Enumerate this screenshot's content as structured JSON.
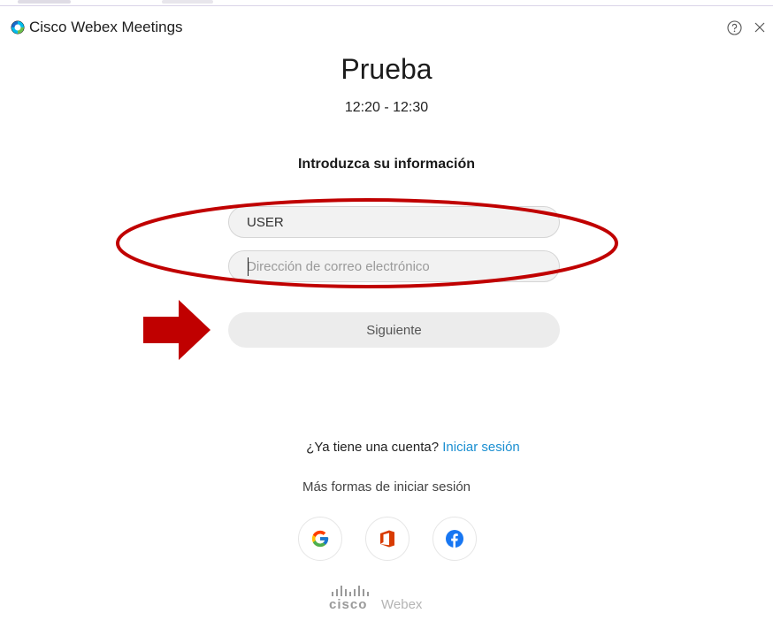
{
  "window": {
    "app_title": "Cisco Webex Meetings",
    "help_icon": "question-circle-icon",
    "close_icon": "close-icon"
  },
  "meeting": {
    "title": "Prueba",
    "time": "12:20 - 12:30"
  },
  "form": {
    "heading": "Introduzca su información",
    "name_value": "USER",
    "email_placeholder": "Dirección de correo electrónico",
    "email_value": "",
    "next_label": "Siguiente"
  },
  "account": {
    "prompt": "¿Ya tiene una cuenta?",
    "signin_label": "Iniciar sesión",
    "more_ways": "Más formas de iniciar sesión"
  },
  "social_buttons": [
    {
      "name": "google-icon",
      "color": "#4285F4"
    },
    {
      "name": "office-icon",
      "color": "#D83B01"
    },
    {
      "name": "facebook-icon",
      "color": "#1877F2"
    }
  ],
  "branding": {
    "cisco": "cisco",
    "webex": "Webex"
  },
  "annotations": {
    "color": "#C00000"
  }
}
